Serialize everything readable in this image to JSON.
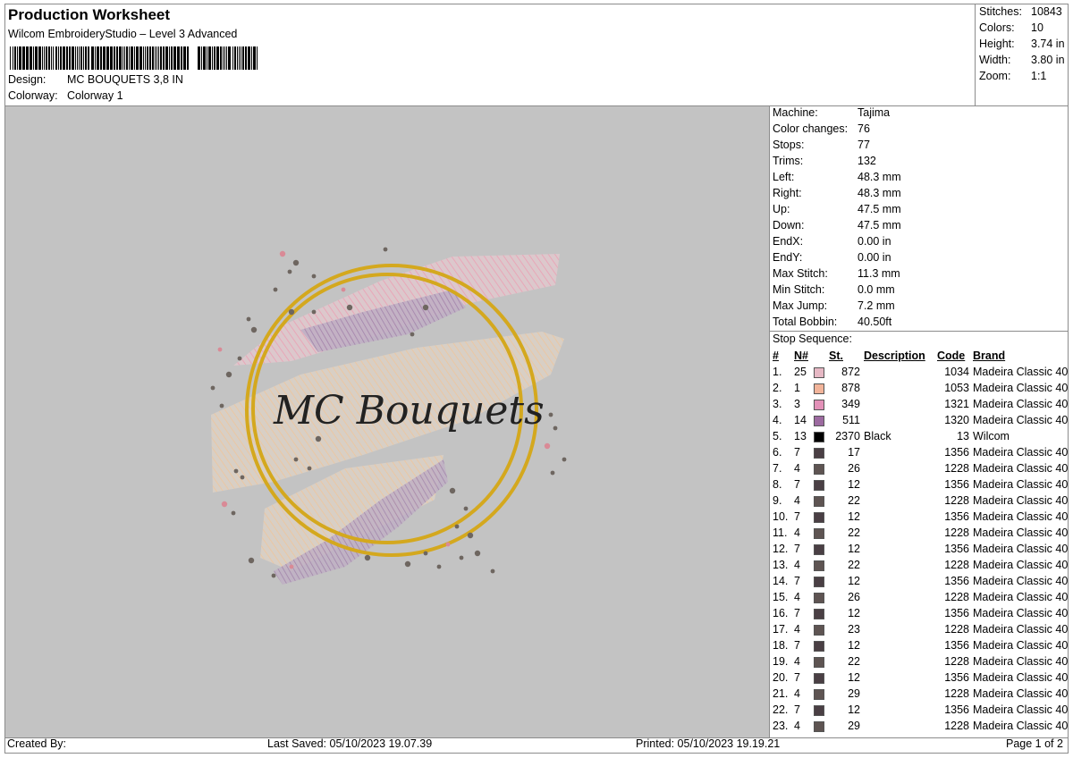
{
  "header": {
    "title": "Production Worksheet",
    "subtitle": "Wilcom EmbroideryStudio – Level 3 Advanced",
    "design_label": "Design:",
    "design_value": "MC BOUQUETS 3,8 IN",
    "colorway_label": "Colorway:",
    "colorway_value": "Colorway 1"
  },
  "summary": [
    {
      "label": "Stitches:",
      "value": "10843"
    },
    {
      "label": "Colors:",
      "value": "10"
    },
    {
      "label": "Height:",
      "value": "3.74 in"
    },
    {
      "label": "Width:",
      "value": "3.80 in"
    },
    {
      "label": "Zoom:",
      "value": "1:1"
    }
  ],
  "preview": {
    "logo_text": "MC Bouquets",
    "background": "#c3c3c3",
    "ring_color": "#d4a81e"
  },
  "properties": [
    {
      "label": "Machine:",
      "value": "Tajima"
    },
    {
      "label": "Color changes:",
      "value": "76"
    },
    {
      "label": "Stops:",
      "value": "77"
    },
    {
      "label": "Trims:",
      "value": "132"
    },
    {
      "label": "Left:",
      "value": "48.3 mm"
    },
    {
      "label": "Right:",
      "value": "48.3 mm"
    },
    {
      "label": "Up:",
      "value": "47.5 mm"
    },
    {
      "label": "Down:",
      "value": "47.5 mm"
    },
    {
      "label": "EndX:",
      "value": "0.00 in"
    },
    {
      "label": "EndY:",
      "value": "0.00 in"
    },
    {
      "label": "Max Stitch:",
      "value": "11.3 mm"
    },
    {
      "label": "Min Stitch:",
      "value": "0.0 mm"
    },
    {
      "label": "Max Jump:",
      "value": "7.2 mm"
    },
    {
      "label": "Total Bobbin:",
      "value": "40.50ft"
    }
  ],
  "stop_sequence": {
    "title": "Stop Sequence:",
    "columns": [
      "#",
      "N#",
      "St.",
      "Description",
      "Code",
      "Brand"
    ],
    "rows": [
      {
        "idx": "1.",
        "n": "25",
        "color": "#e6b8c4",
        "st": "872",
        "desc": "",
        "code": "1034",
        "brand": "Madeira Classic 40"
      },
      {
        "idx": "2.",
        "n": "1",
        "color": "#f2b49a",
        "st": "878",
        "desc": "",
        "code": "1053",
        "brand": "Madeira Classic 40"
      },
      {
        "idx": "3.",
        "n": "3",
        "color": "#e391b8",
        "st": "349",
        "desc": "",
        "code": "1321",
        "brand": "Madeira Classic 40"
      },
      {
        "idx": "4.",
        "n": "14",
        "color": "#9c6aa0",
        "st": "511",
        "desc": "",
        "code": "1320",
        "brand": "Madeira Classic 40"
      },
      {
        "idx": "5.",
        "n": "13",
        "color": "#000000",
        "st": "2370",
        "desc": "Black",
        "code": "13",
        "brand": "Wilcom"
      },
      {
        "idx": "6.",
        "n": "7",
        "color": "#4a3f44",
        "st": "17",
        "desc": "",
        "code": "1356",
        "brand": "Madeira Classic 40"
      },
      {
        "idx": "7.",
        "n": "4",
        "color": "#5e5452",
        "st": "26",
        "desc": "",
        "code": "1228",
        "brand": "Madeira Classic 40"
      },
      {
        "idx": "8.",
        "n": "7",
        "color": "#4a3f44",
        "st": "12",
        "desc": "",
        "code": "1356",
        "brand": "Madeira Classic 40"
      },
      {
        "idx": "9.",
        "n": "4",
        "color": "#5e5452",
        "st": "22",
        "desc": "",
        "code": "1228",
        "brand": "Madeira Classic 40"
      },
      {
        "idx": "10.",
        "n": "7",
        "color": "#4a3f44",
        "st": "12",
        "desc": "",
        "code": "1356",
        "brand": "Madeira Classic 40"
      },
      {
        "idx": "11.",
        "n": "4",
        "color": "#5e5452",
        "st": "22",
        "desc": "",
        "code": "1228",
        "brand": "Madeira Classic 40"
      },
      {
        "idx": "12.",
        "n": "7",
        "color": "#4a3f44",
        "st": "12",
        "desc": "",
        "code": "1356",
        "brand": "Madeira Classic 40"
      },
      {
        "idx": "13.",
        "n": "4",
        "color": "#5e5452",
        "st": "22",
        "desc": "",
        "code": "1228",
        "brand": "Madeira Classic 40"
      },
      {
        "idx": "14.",
        "n": "7",
        "color": "#4a3f44",
        "st": "12",
        "desc": "",
        "code": "1356",
        "brand": "Madeira Classic 40"
      },
      {
        "idx": "15.",
        "n": "4",
        "color": "#5e5452",
        "st": "26",
        "desc": "",
        "code": "1228",
        "brand": "Madeira Classic 40"
      },
      {
        "idx": "16.",
        "n": "7",
        "color": "#4a3f44",
        "st": "12",
        "desc": "",
        "code": "1356",
        "brand": "Madeira Classic 40"
      },
      {
        "idx": "17.",
        "n": "4",
        "color": "#5e5452",
        "st": "23",
        "desc": "",
        "code": "1228",
        "brand": "Madeira Classic 40"
      },
      {
        "idx": "18.",
        "n": "7",
        "color": "#4a3f44",
        "st": "12",
        "desc": "",
        "code": "1356",
        "brand": "Madeira Classic 40"
      },
      {
        "idx": "19.",
        "n": "4",
        "color": "#5e5452",
        "st": "22",
        "desc": "",
        "code": "1228",
        "brand": "Madeira Classic 40"
      },
      {
        "idx": "20.",
        "n": "7",
        "color": "#4a3f44",
        "st": "12",
        "desc": "",
        "code": "1356",
        "brand": "Madeira Classic 40"
      },
      {
        "idx": "21.",
        "n": "4",
        "color": "#5e5452",
        "st": "29",
        "desc": "",
        "code": "1228",
        "brand": "Madeira Classic 40"
      },
      {
        "idx": "22.",
        "n": "7",
        "color": "#4a3f44",
        "st": "12",
        "desc": "",
        "code": "1356",
        "brand": "Madeira Classic 40"
      },
      {
        "idx": "23.",
        "n": "4",
        "color": "#5e5452",
        "st": "29",
        "desc": "",
        "code": "1228",
        "brand": "Madeira Classic 40"
      }
    ]
  },
  "footer": {
    "created_by": "Created By:",
    "last_saved": "Last Saved: 05/10/2023 19.07.39",
    "printed": "Printed: 05/10/2023 19.19.21",
    "page": "Page 1 of 2"
  }
}
